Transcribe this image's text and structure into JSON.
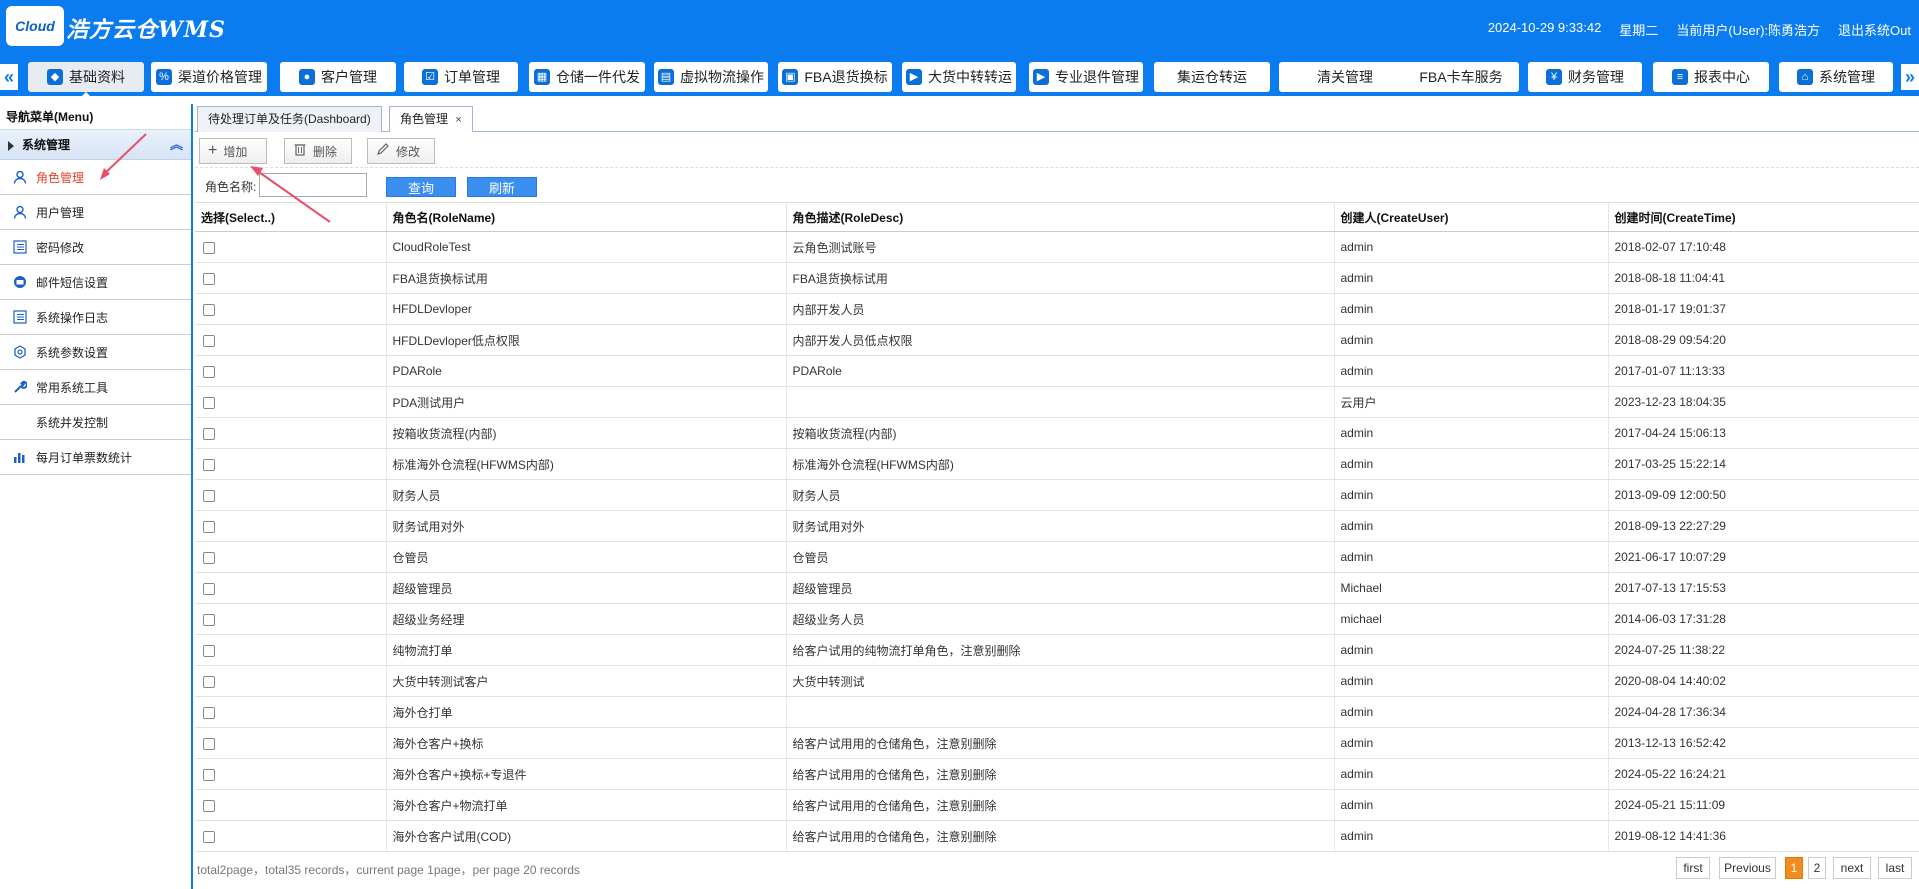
{
  "header": {
    "logo_text": "Cloud",
    "app_title": "浩方云仓WMS",
    "datetime": "2024-10-29 9:33:42",
    "weekday": "星期二",
    "current_user": "当前用户(User):陈勇浩方",
    "logout": "退出系统Out"
  },
  "topnav": {
    "items": [
      {
        "label": "基础资料",
        "icon": "tag-icon"
      },
      {
        "label": "渠道价格管理",
        "icon": "price-icon"
      },
      {
        "label": "客户管理",
        "icon": "user-icon"
      },
      {
        "label": "订单管理",
        "icon": "order-icon"
      },
      {
        "label": "仓储一件代发",
        "icon": "warehouse-icon"
      },
      {
        "label": "虚拟物流操作",
        "icon": "logistics-icon"
      },
      {
        "label": "FBA退货换标",
        "icon": "return-icon"
      },
      {
        "label": "大货中转转运",
        "icon": "truck-icon"
      },
      {
        "label": "专业退件管理",
        "icon": "truck-icon"
      },
      {
        "label": "集运仓转运",
        "icon": ""
      },
      {
        "label": "清关管理",
        "icon": ""
      },
      {
        "label": "FBA卡车服务",
        "icon": ""
      },
      {
        "label": "财务管理",
        "icon": "finance-icon"
      },
      {
        "label": "报表中心",
        "icon": "database-icon"
      },
      {
        "label": "系统管理",
        "icon": "system-icon"
      }
    ]
  },
  "sidebar": {
    "header": "导航菜单(Menu)",
    "group": "系统管理",
    "items": [
      {
        "label": "角色管理",
        "icon": "user-outline-icon"
      },
      {
        "label": "用户管理",
        "icon": "user-outline-icon"
      },
      {
        "label": "密码修改",
        "icon": "list-icon"
      },
      {
        "label": "邮件短信设置",
        "icon": "mail-icon"
      },
      {
        "label": "系统操作日志",
        "icon": "list-icon"
      },
      {
        "label": "系统参数设置",
        "icon": "gear-icon"
      },
      {
        "label": "常用系统工具",
        "icon": "wrench-icon"
      },
      {
        "label": "系统并发控制",
        "icon": ""
      },
      {
        "label": "每月订单票数统计",
        "icon": "bar-chart-icon"
      }
    ]
  },
  "tabs": [
    {
      "label": "待处理订单及任务(Dashboard)"
    },
    {
      "label": "角色管理",
      "close": "×"
    }
  ],
  "toolbar": {
    "add": "增加",
    "delete": "删除",
    "edit": "修改"
  },
  "search": {
    "label": "角色名称:",
    "value": "",
    "query": "查询",
    "refresh": "刷新"
  },
  "table": {
    "columns": [
      "选择(Select..)",
      "角色名(RoleName)",
      "角色描述(RoleDesc)",
      "创建人(CreateUser)",
      "创建时间(CreateTime)"
    ],
    "rows": [
      [
        "CloudRoleTest",
        "云角色测试账号",
        "admin",
        "2018-02-07 17:10:48"
      ],
      [
        "FBA退货换标试用",
        "FBA退货换标试用",
        "admin",
        "2018-08-18 11:04:41"
      ],
      [
        "HFDLDevloper",
        "内部开发人员",
        "admin",
        "2018-01-17 19:01:37"
      ],
      [
        "HFDLDevloper低点权限",
        "内部开发人员低点权限",
        "admin",
        "2018-08-29 09:54:20"
      ],
      [
        "PDARole",
        "PDARole",
        "admin",
        "2017-01-07 11:13:33"
      ],
      [
        "PDA测试用户",
        "",
        "云用户",
        "2023-12-23 18:04:35"
      ],
      [
        "按箱收货流程(内部)",
        "按箱收货流程(内部)",
        "admin",
        "2017-04-24 15:06:13"
      ],
      [
        "标准海外仓流程(HFWMS内部)",
        "标准海外仓流程(HFWMS内部)",
        "admin",
        "2017-03-25 15:22:14"
      ],
      [
        "财务人员",
        "财务人员",
        "admin",
        "2013-09-09 12:00:50"
      ],
      [
        "财务试用对外",
        "财务试用对外",
        "admin",
        "2018-09-13 22:27:29"
      ],
      [
        "仓管员",
        "仓管员",
        "admin",
        "2021-06-17 10:07:29"
      ],
      [
        "超级管理员",
        "超级管理员",
        "Michael",
        "2017-07-13 17:15:53"
      ],
      [
        "超级业务经理",
        "超级业务人员",
        "michael",
        "2014-06-03 17:31:28"
      ],
      [
        "纯物流打单",
        "给客户试用的纯物流打单角色，注意别删除",
        "admin",
        "2024-07-25 11:38:22"
      ],
      [
        "大货中转测试客户",
        "大货中转测试",
        "admin",
        "2020-08-04 14:40:02"
      ],
      [
        "海外仓打单",
        "",
        "admin",
        "2024-04-28 17:36:34"
      ],
      [
        "海外仓客户+换标",
        "给客户试用用的仓储角色，注意别删除",
        "admin",
        "2013-12-13 16:52:42"
      ],
      [
        "海外仓客户+换标+专退件",
        "给客户试用用的仓储角色，注意别删除",
        "admin",
        "2024-05-22 16:24:21"
      ],
      [
        "海外仓客户+物流打单",
        "给客户试用用的仓储角色，注意别删除",
        "admin",
        "2024-05-21 15:11:09"
      ],
      [
        "海外仓客户试用(COD)",
        "给客户试用用的仓储角色，注意别删除",
        "admin",
        "2019-08-12 14:41:36"
      ]
    ]
  },
  "pagination": {
    "info": "total2page，total35 records，current page 1page，per page 20 records",
    "first": "first",
    "previous": "Previous",
    "pages": [
      "1",
      "2"
    ],
    "next": "next",
    "last": "last"
  },
  "colors": {
    "brand_blue": "#0a7cf0",
    "active_red": "#e8402a",
    "page_current": "#f38c1f"
  }
}
